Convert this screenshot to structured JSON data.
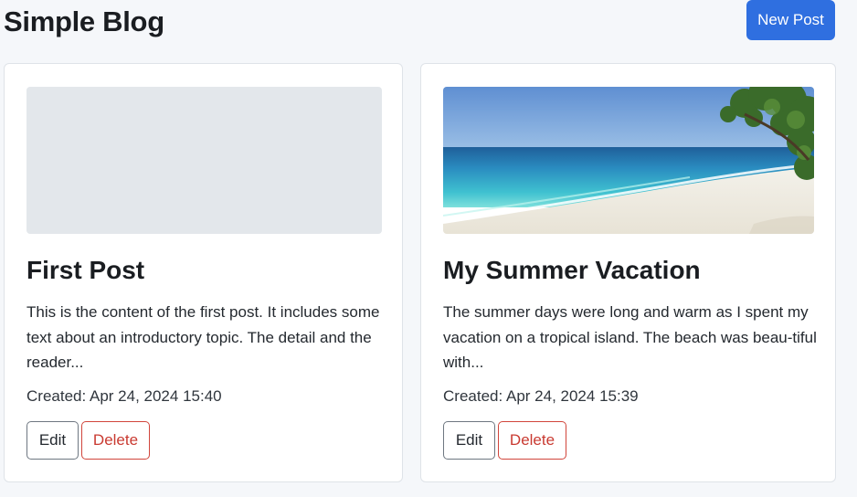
{
  "header": {
    "title": "Simple Blog",
    "new_post_label": "New Post"
  },
  "posts": [
    {
      "title": "First Post",
      "excerpt": "This is the content of the first post. It includes some text about an introductory topic. The detail and the reader...",
      "created": "Created: Apr 24, 2024 15:40",
      "image": "placeholder",
      "edit_label": "Edit",
      "delete_label": "Delete"
    },
    {
      "title": "My Summer Vacation",
      "excerpt": "The summer days were long and warm as I spent my vacation on a tropical island. The beach was beau-tiful with...",
      "created": "Created: Apr 24, 2024 15:39",
      "image": "beach-photo",
      "edit_label": "Edit",
      "delete_label": "Delete"
    }
  ],
  "colors": {
    "primary": "#2f6fe0",
    "danger": "#c93a31",
    "page_background": "#f5f7fa",
    "placeholder": "#e3e7eb"
  }
}
